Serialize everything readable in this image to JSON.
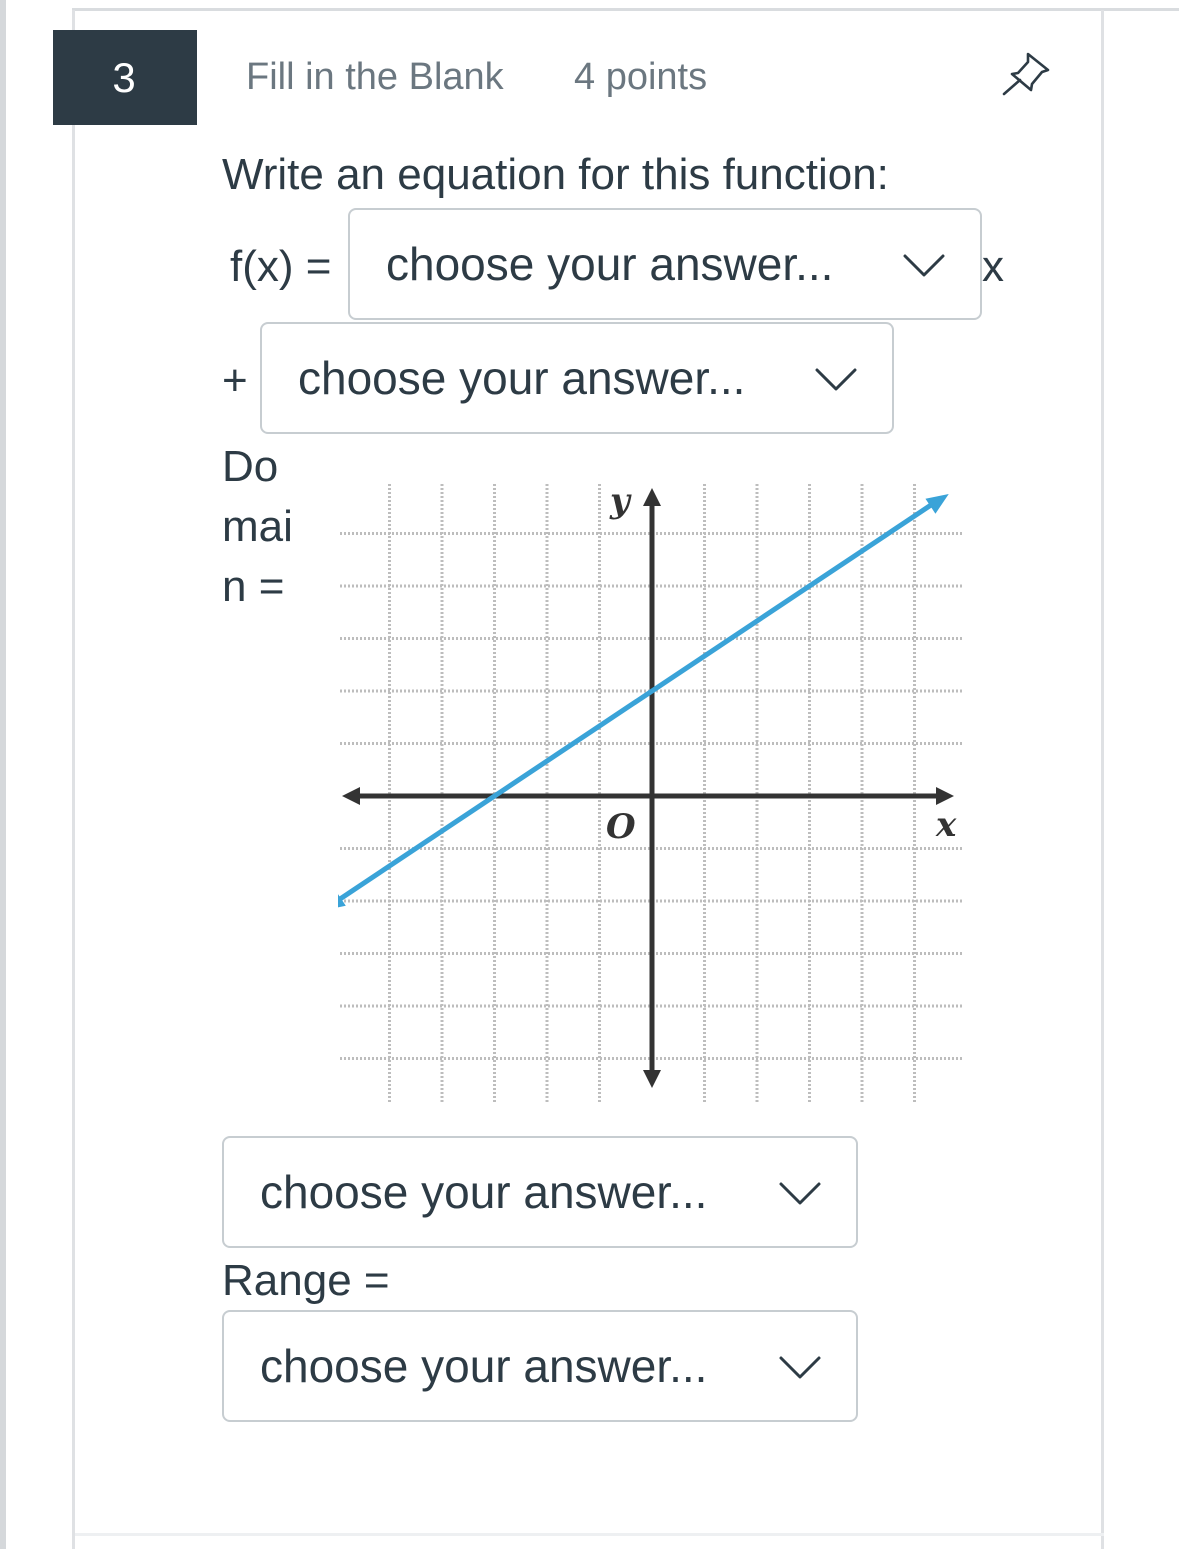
{
  "question": {
    "number": "3",
    "type": "Fill in the Blank",
    "points": "4 points",
    "prompt": "Write an equation for this function:"
  },
  "equation": {
    "lhs": "f(x) =",
    "slope_select": {
      "value": "choose your answer..."
    },
    "x_suffix": "x",
    "plus": "+",
    "intercept_select": {
      "value": "choose your answer..."
    }
  },
  "domain": {
    "label_lines": [
      "Do",
      "mai",
      "n ="
    ],
    "select": {
      "value": "choose your answer..."
    }
  },
  "range": {
    "label": "Range =",
    "select": {
      "value": "choose your answer..."
    }
  },
  "graph": {
    "axis_y_label": "y",
    "axis_x_label": "x",
    "origin_label": "O",
    "line_color": "#3aa3d8"
  },
  "chart_data": {
    "type": "line",
    "x_range": [
      -6,
      6
    ],
    "y_range": [
      -5,
      6
    ],
    "grid": true,
    "series": [
      {
        "points": [
          [
            -6,
            -2
          ],
          [
            -3,
            0
          ],
          [
            0,
            2
          ],
          [
            3,
            4
          ],
          [
            6,
            6
          ]
        ]
      }
    ]
  },
  "icons": {
    "pin": "pin-icon",
    "chevron": "chevron-down-icon"
  }
}
